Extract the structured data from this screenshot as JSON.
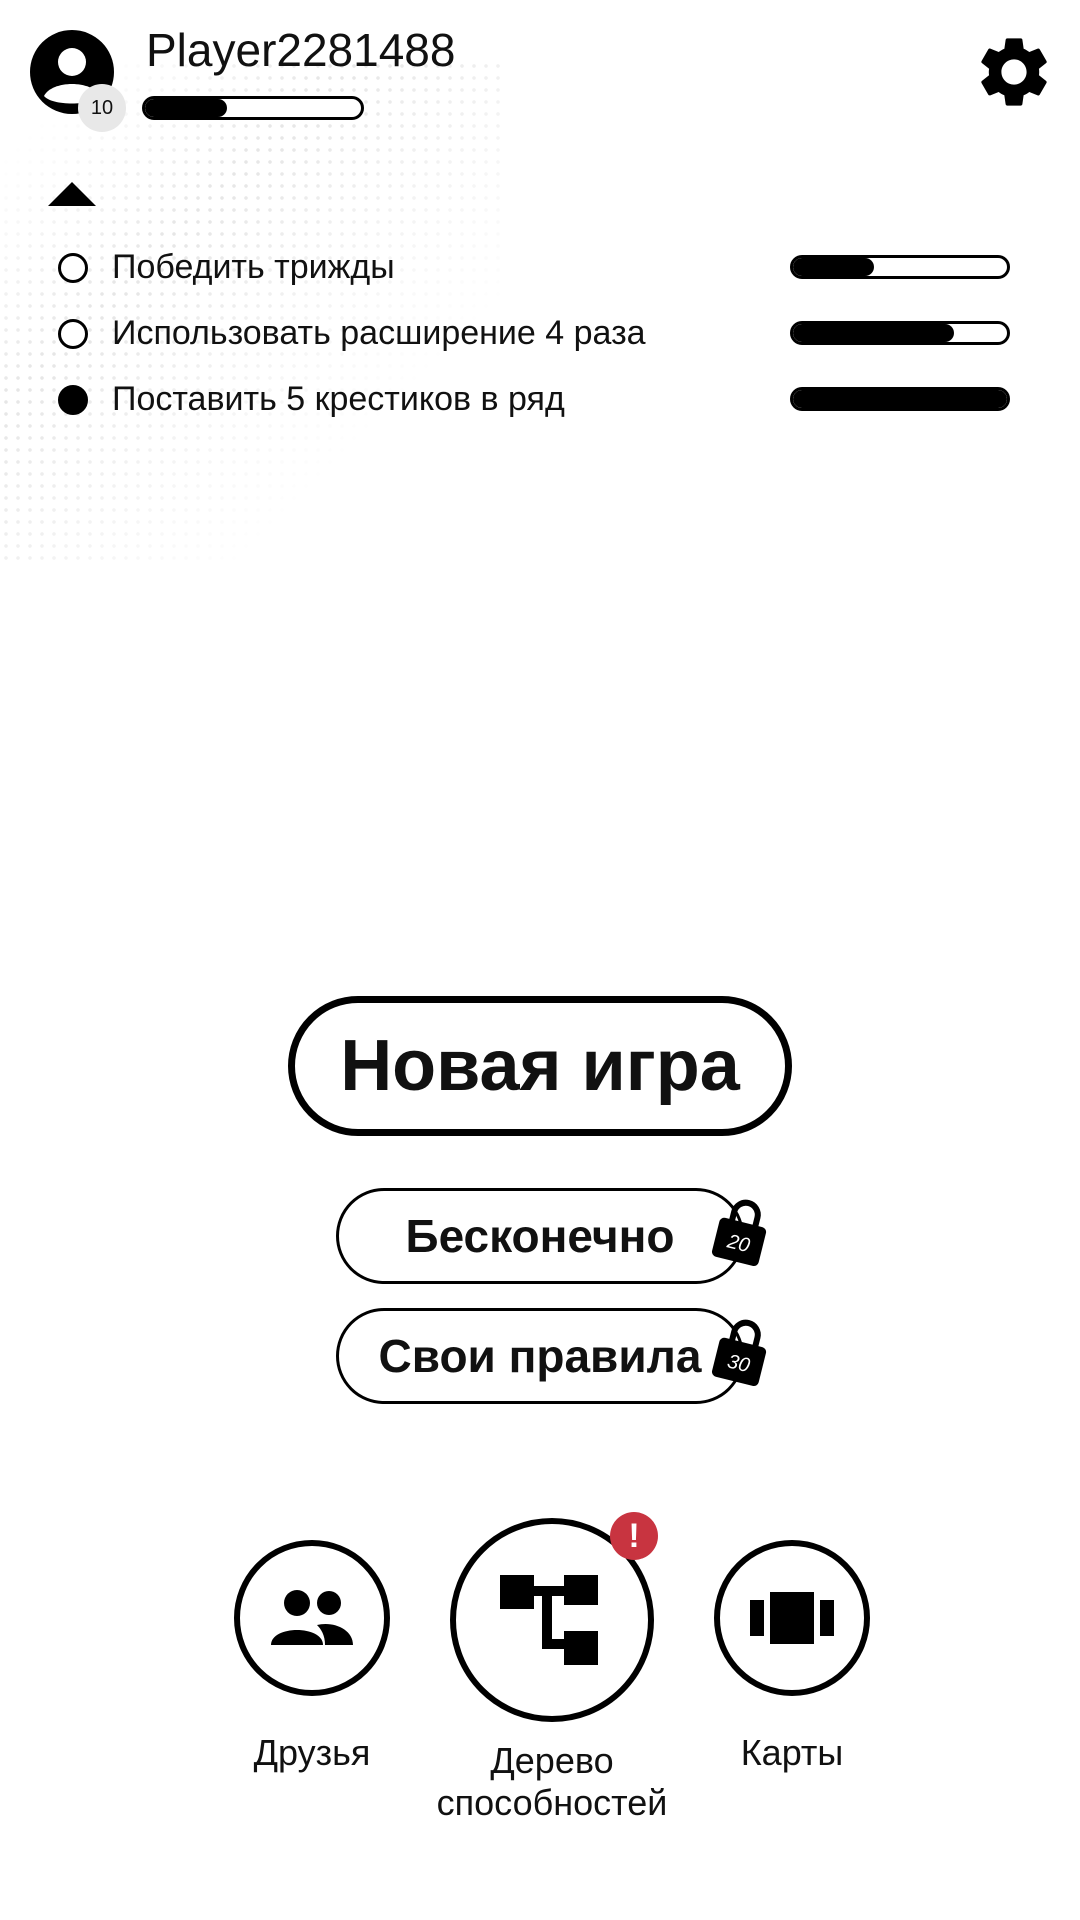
{
  "header": {
    "player_name": "Player2281488",
    "level": "10",
    "xp_progress": 0.38,
    "avatar_icon": "account-circle-icon",
    "settings_icon": "gear-icon"
  },
  "quests": {
    "toggle_icon": "triangle-up-icon",
    "items": [
      {
        "label": "Победить трижды",
        "completed": false,
        "progress": 0.38
      },
      {
        "label": "Использовать расширение 4 раза",
        "completed": false,
        "progress": 0.75
      },
      {
        "label": "Поставить 5 крестиков в ряд",
        "completed": true,
        "progress": 1.0
      }
    ]
  },
  "main": {
    "new_game_label": "Новая игра",
    "modes": [
      {
        "label": "Бесконечно",
        "locked": true,
        "unlock_level": "20"
      },
      {
        "label": "Свои правила",
        "locked": true,
        "unlock_level": "30"
      }
    ]
  },
  "bottom_nav": {
    "friends": {
      "label": "Друзья",
      "icon": "people-icon"
    },
    "skill_tree": {
      "label_line1": "Дерево",
      "label_line2": "способностей",
      "icon": "tree-icon",
      "notification": "!"
    },
    "cards": {
      "label": "Карты",
      "icon": "cards-icon"
    }
  },
  "colors": {
    "primary": "#000000",
    "background": "#ffffff",
    "notification": "#c83440",
    "badge_bg": "#e8e8e8"
  }
}
